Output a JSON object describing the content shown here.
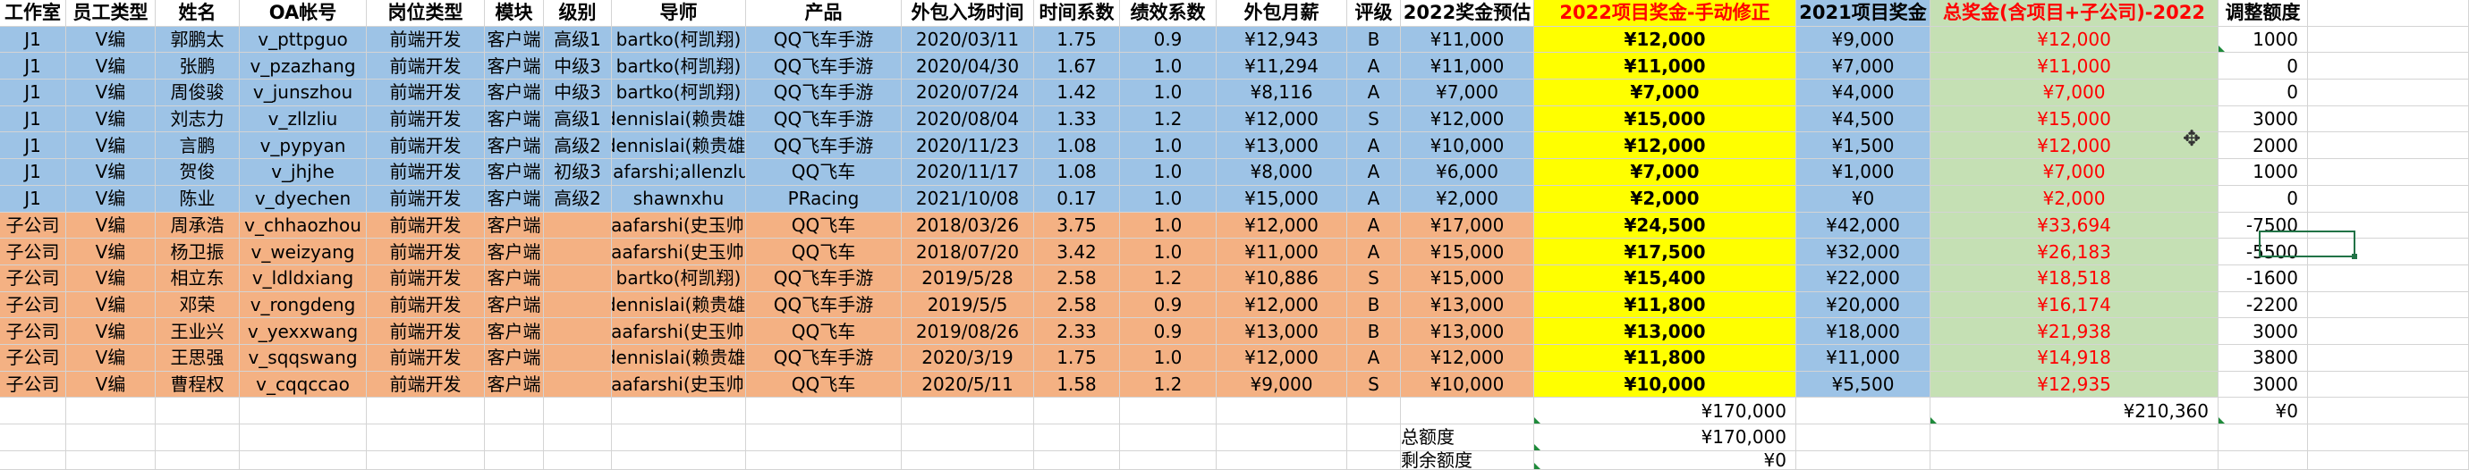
{
  "headers": [
    "工作室",
    "员工类型",
    "姓名",
    "OA帐号",
    "岗位类型",
    "模块",
    "级别",
    "导师",
    "产品",
    "外包入场时间",
    "时间系数",
    "绩效系数",
    "外包月薪",
    "评级",
    "2022奖金预估",
    "2022项目奖金-手动修正",
    "2021项目奖金",
    "总奖金(含项目+子公司)-2022",
    "调整额度"
  ],
  "rows": [
    [
      "J1",
      "V编",
      "郭鹏太",
      "v_pttpguo",
      "前端开发",
      "客户端",
      "高级1",
      "bartko(柯凯翔)",
      "QQ飞车手游",
      "2020/03/11",
      "1.75",
      "0.9",
      "¥12,943",
      "B",
      "¥11,000",
      "¥12,000",
      "¥9,000",
      "¥12,000",
      "1000"
    ],
    [
      "J1",
      "V编",
      "张鹏",
      "v_pzazhang",
      "前端开发",
      "客户端",
      "中级3",
      "bartko(柯凯翔)",
      "QQ飞车手游",
      "2020/04/30",
      "1.67",
      "1.0",
      "¥11,294",
      "A",
      "¥11,000",
      "¥11,000",
      "¥7,000",
      "¥11,000",
      "0"
    ],
    [
      "J1",
      "V编",
      "周俊骏",
      "v_junszhou",
      "前端开发",
      "客户端",
      "中级3",
      "bartko(柯凯翔)",
      "QQ飞车手游",
      "2020/07/24",
      "1.42",
      "1.0",
      "¥8,116",
      "A",
      "¥7,000",
      "¥7,000",
      "¥4,000",
      "¥7,000",
      "0"
    ],
    [
      "J1",
      "V编",
      "刘志力",
      "v_zllzliu",
      "前端开发",
      "客户端",
      "高级1",
      "dennislai(赖贵雄)",
      "QQ飞车手游",
      "2020/08/04",
      "1.33",
      "1.2",
      "¥12,000",
      "S",
      "¥12,000",
      "¥15,000",
      "¥4,500",
      "¥15,000",
      "3000"
    ],
    [
      "J1",
      "V编",
      "言鹏",
      "v_pypyan",
      "前端开发",
      "客户端",
      "高级2",
      "dennislai(赖贵雄)",
      "QQ飞车手游",
      "2020/11/23",
      "1.08",
      "1.0",
      "¥13,000",
      "A",
      "¥10,000",
      "¥12,000",
      "¥1,500",
      "¥12,000",
      "2000"
    ],
    [
      "J1",
      "V编",
      "贺俊",
      "v_jhjhe",
      "前端开发",
      "客户端",
      "初级3",
      "jaafarshi;allenzluo",
      "QQ飞车",
      "2020/11/17",
      "1.08",
      "1.0",
      "¥8,000",
      "A",
      "¥6,000",
      "¥7,000",
      "¥1,000",
      "¥7,000",
      "1000"
    ],
    [
      "J1",
      "V编",
      "陈业",
      "v_dyechen",
      "前端开发",
      "客户端",
      "高级2",
      "shawnxhu",
      "PRacing",
      "2021/10/08",
      "0.17",
      "1.0",
      "¥15,000",
      "A",
      "¥2,000",
      "¥2,000",
      "¥0",
      "¥2,000",
      "0"
    ],
    [
      "子公司",
      "V编",
      "周承浩",
      "v_chhaozhou",
      "前端开发",
      "客户端",
      "",
      "jaafarshi(史玉帅)",
      "QQ飞车",
      "2018/03/26",
      "3.75",
      "1.0",
      "¥12,000",
      "A",
      "¥17,000",
      "¥24,500",
      "¥42,000",
      "¥33,694",
      "-7500"
    ],
    [
      "子公司",
      "V编",
      "杨卫振",
      "v_weizyang",
      "前端开发",
      "客户端",
      "",
      "jaafarshi(史玉帅)",
      "QQ飞车",
      "2018/07/20",
      "3.42",
      "1.0",
      "¥11,000",
      "A",
      "¥15,000",
      "¥17,500",
      "¥32,000",
      "¥26,183",
      "-5500"
    ],
    [
      "子公司",
      "V编",
      "相立东",
      "v_ldldxiang",
      "前端开发",
      "客户端",
      "",
      "bartko(柯凯翔)",
      "QQ飞车手游",
      "2019/5/28",
      "2.58",
      "1.2",
      "¥10,886",
      "S",
      "¥15,000",
      "¥15,400",
      "¥22,000",
      "¥18,518",
      "-1600"
    ],
    [
      "子公司",
      "V编",
      "邓荣",
      "v_rongdeng",
      "前端开发",
      "客户端",
      "",
      "dennislai(赖贵雄)",
      "QQ飞车手游",
      "2019/5/5",
      "2.58",
      "0.9",
      "¥12,000",
      "B",
      "¥13,000",
      "¥11,800",
      "¥20,000",
      "¥16,174",
      "-2200"
    ],
    [
      "子公司",
      "V编",
      "王业兴",
      "v_yexxwang",
      "前端开发",
      "客户端",
      "",
      "jaafarshi(史玉帅)",
      "QQ飞车",
      "2019/08/26",
      "2.33",
      "0.9",
      "¥13,000",
      "B",
      "¥13,000",
      "¥13,000",
      "¥18,000",
      "¥21,938",
      "3000"
    ],
    [
      "子公司",
      "V编",
      "王思强",
      "v_sqqswang",
      "前端开发",
      "客户端",
      "",
      "dennislai(赖贵雄)",
      "QQ飞车手游",
      "2020/3/19",
      "1.75",
      "1.0",
      "¥12,000",
      "A",
      "¥12,000",
      "¥11,800",
      "¥11,000",
      "¥14,918",
      "3800"
    ],
    [
      "子公司",
      "V编",
      "曹程权",
      "v_cqqccao",
      "前端开发",
      "客户端",
      "",
      "jaafarshi(史玉帅)",
      "QQ飞车",
      "2020/5/11",
      "1.58",
      "1.2",
      "¥9,000",
      "S",
      "¥10,000",
      "¥10,000",
      "¥5,500",
      "¥12,935",
      "3000"
    ]
  ],
  "totals": {
    "manual_sum": "¥170,000",
    "total_sum": "¥210,360",
    "adjust_sum": "¥0",
    "total_quota_label": "总额度",
    "total_quota_value": "¥170,000",
    "remaining_label": "剩余额度",
    "remaining_value": "¥0"
  },
  "colors": {
    "j1_row": "#9dc3e6",
    "subsidiary_row": "#f4b183",
    "manual_column": "#ffff00",
    "total_column": "#c5e0b4",
    "red_text": "#ff0000"
  }
}
